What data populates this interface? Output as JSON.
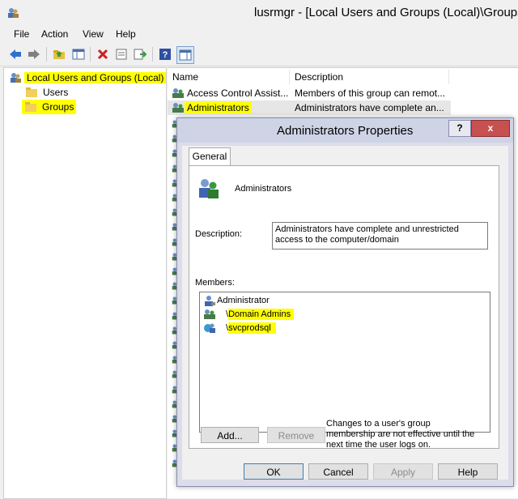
{
  "window": {
    "title": "lusrmgr - [Local Users and Groups (Local)\\Groups",
    "menu": [
      "File",
      "Action",
      "View",
      "Help"
    ]
  },
  "toolbar": {
    "buttons": [
      "back-arrow-icon",
      "forward-arrow-icon",
      "up-folder-icon",
      "show-hide-tree-icon",
      "delete-icon",
      "properties-icon",
      "export-list-icon",
      "help-icon",
      "console-view-icon"
    ]
  },
  "tree": {
    "root": "Local Users and Groups (Local)",
    "items": [
      "Users",
      "Groups"
    ]
  },
  "list": {
    "columns": [
      "Name",
      "Description"
    ],
    "rows": [
      {
        "name": "Access Control Assist...",
        "desc": "Members of this group can remot..."
      },
      {
        "name": "Administrators",
        "desc": "Administrators have complete an..."
      }
    ],
    "extra_row_count_visual": 24
  },
  "dialog": {
    "title": "Administrators Properties",
    "help": "?",
    "close": "x",
    "tab": "General",
    "group_name": "Administrators",
    "description_label": "Description:",
    "description_value": "Administrators have complete and unrestricted access to the computer/domain",
    "members_label": "Members:",
    "members": [
      {
        "text": "Administrator",
        "highlight": false
      },
      {
        "prefix": "\\",
        "text": "Domain Admins",
        "highlight": true
      },
      {
        "prefix": "\\",
        "text": "svcprodsql",
        "highlight": true
      }
    ],
    "add_button": "Add...",
    "remove_button": "Remove",
    "note": "Changes to a user's group membership are not effective until the next time the user logs on.",
    "ok": "OK",
    "cancel": "Cancel",
    "apply": "Apply",
    "help_button": "Help"
  },
  "colors": {
    "highlight": "#ffff00",
    "close_red": "#c75050",
    "dialog_frame": "#ced3e6"
  }
}
